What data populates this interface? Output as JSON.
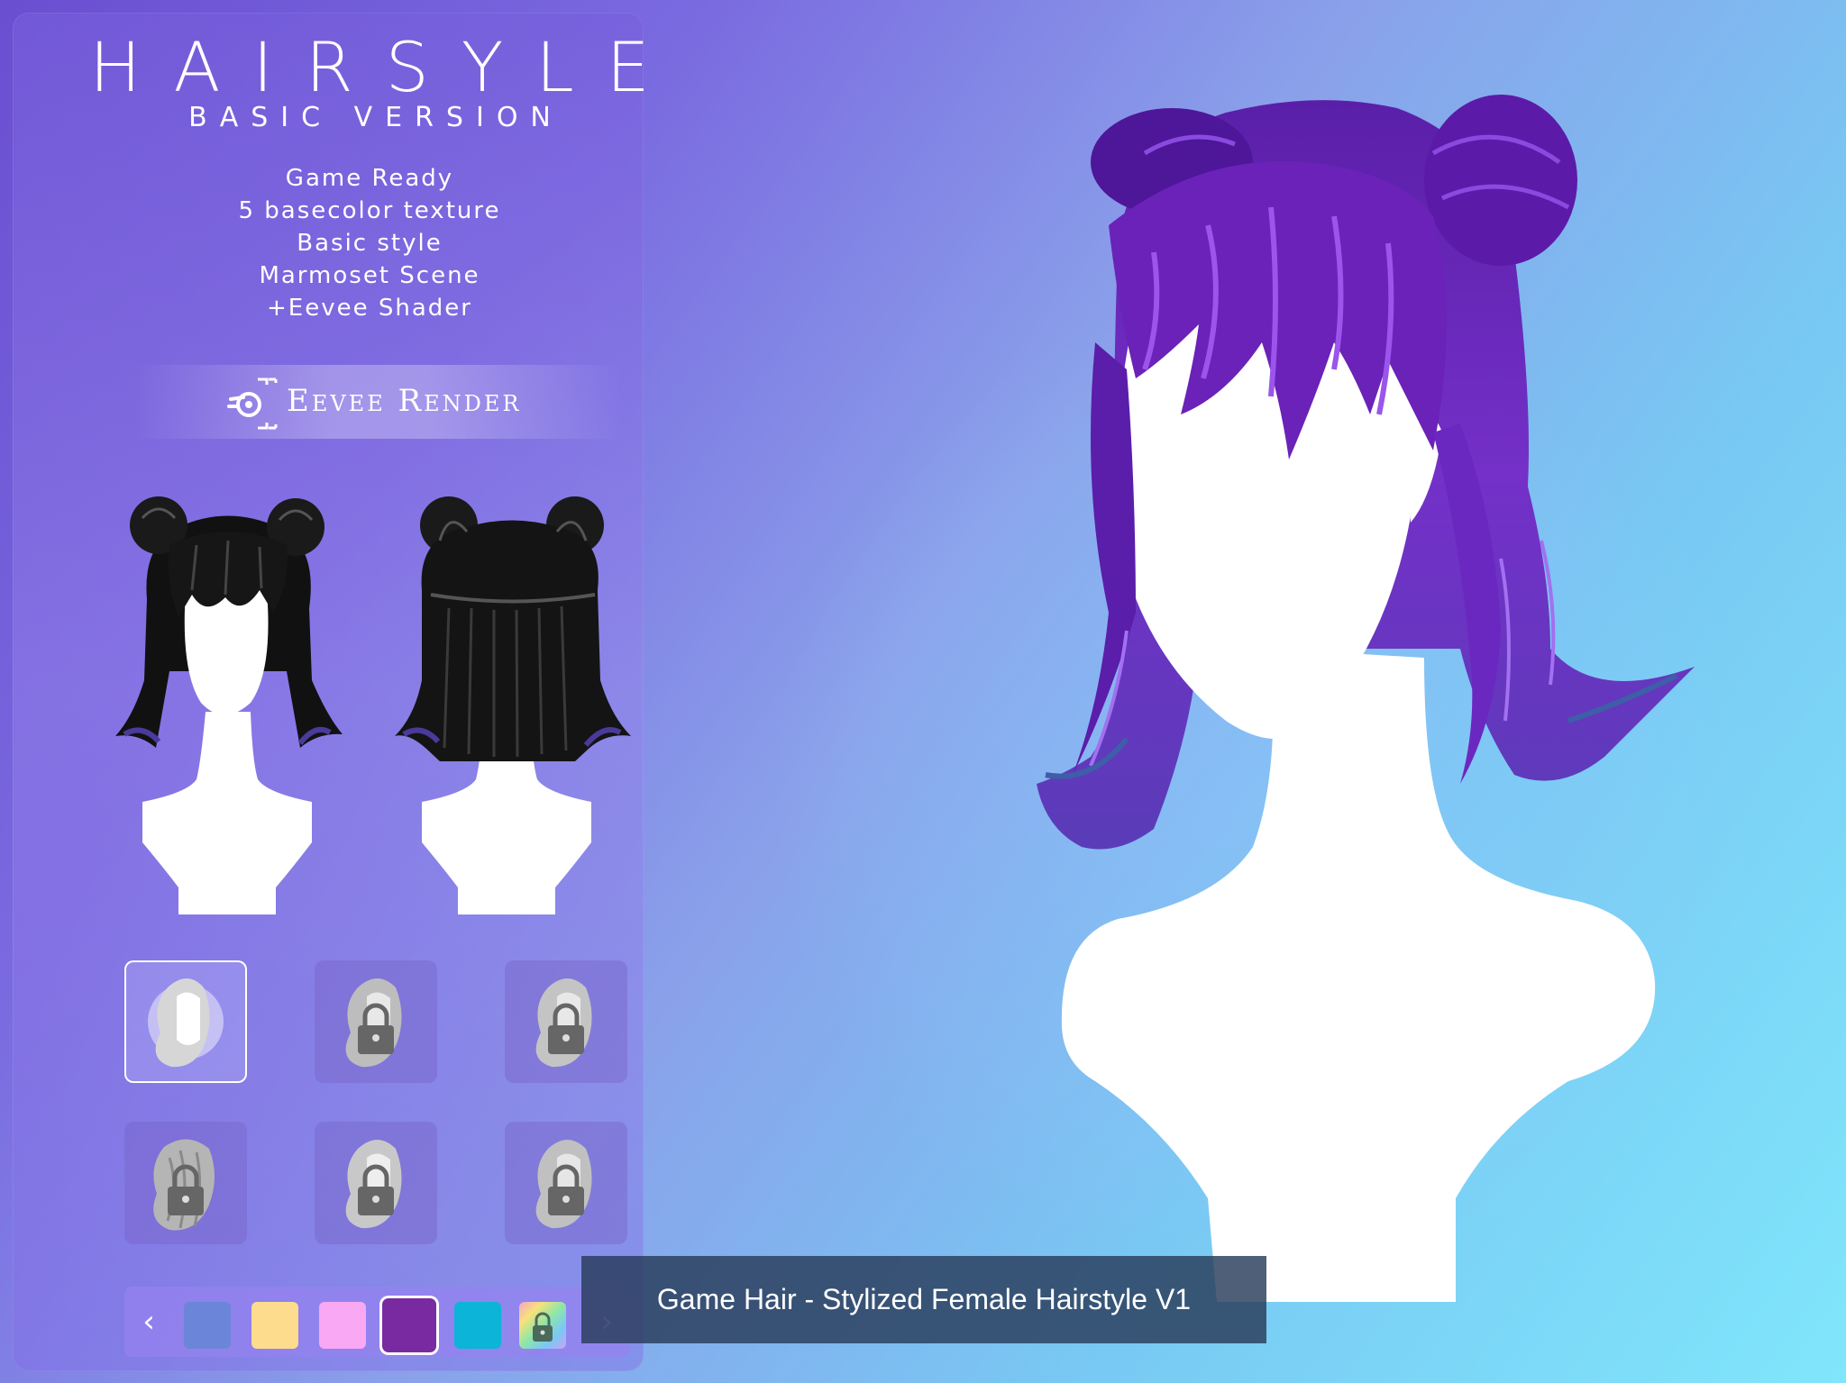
{
  "header": {
    "title": "HAIRSYLE",
    "subtitle": "BASIC VERSION"
  },
  "features": [
    "Game Ready",
    "5 basecolor texture",
    "Basic style",
    "Marmoset Scene",
    "+Eevee Shader"
  ],
  "render_badge": {
    "label": "Eevee Render",
    "icon": "blender-eevee-icon"
  },
  "previews": {
    "front": "front-view-black-hair",
    "back": "back-view-black-hair"
  },
  "style_variants": [
    {
      "icon": "hair-style-icon",
      "locked": false,
      "selected": true
    },
    {
      "icon": "hair-style-icon",
      "locked": true,
      "selected": false
    },
    {
      "icon": "hair-style-icon",
      "locked": true,
      "selected": false
    },
    {
      "icon": "hair-style-icon",
      "locked": true,
      "selected": false
    },
    {
      "icon": "hair-style-icon",
      "locked": true,
      "selected": false
    },
    {
      "icon": "hair-style-icon",
      "locked": true,
      "selected": false
    }
  ],
  "color_swatches": [
    {
      "color": "#6b86d8",
      "selected": false
    },
    {
      "color": "#fddc8e",
      "selected": false
    },
    {
      "color": "#f9a8f3",
      "selected": false
    },
    {
      "color": "#7a2aa0",
      "selected": true
    },
    {
      "color": "#0cb4d8",
      "selected": false
    },
    {
      "color": "rainbow",
      "locked": true,
      "selected": false
    }
  ],
  "nav": {
    "prev": "‹",
    "next": "›"
  },
  "caption": "Game Hair - Stylized Female Hairstyle V1",
  "colors": {
    "hair_main": "#6a22b8",
    "hair_highlight": "#8a3ce0",
    "hair_preview": "#1a1a1a"
  }
}
